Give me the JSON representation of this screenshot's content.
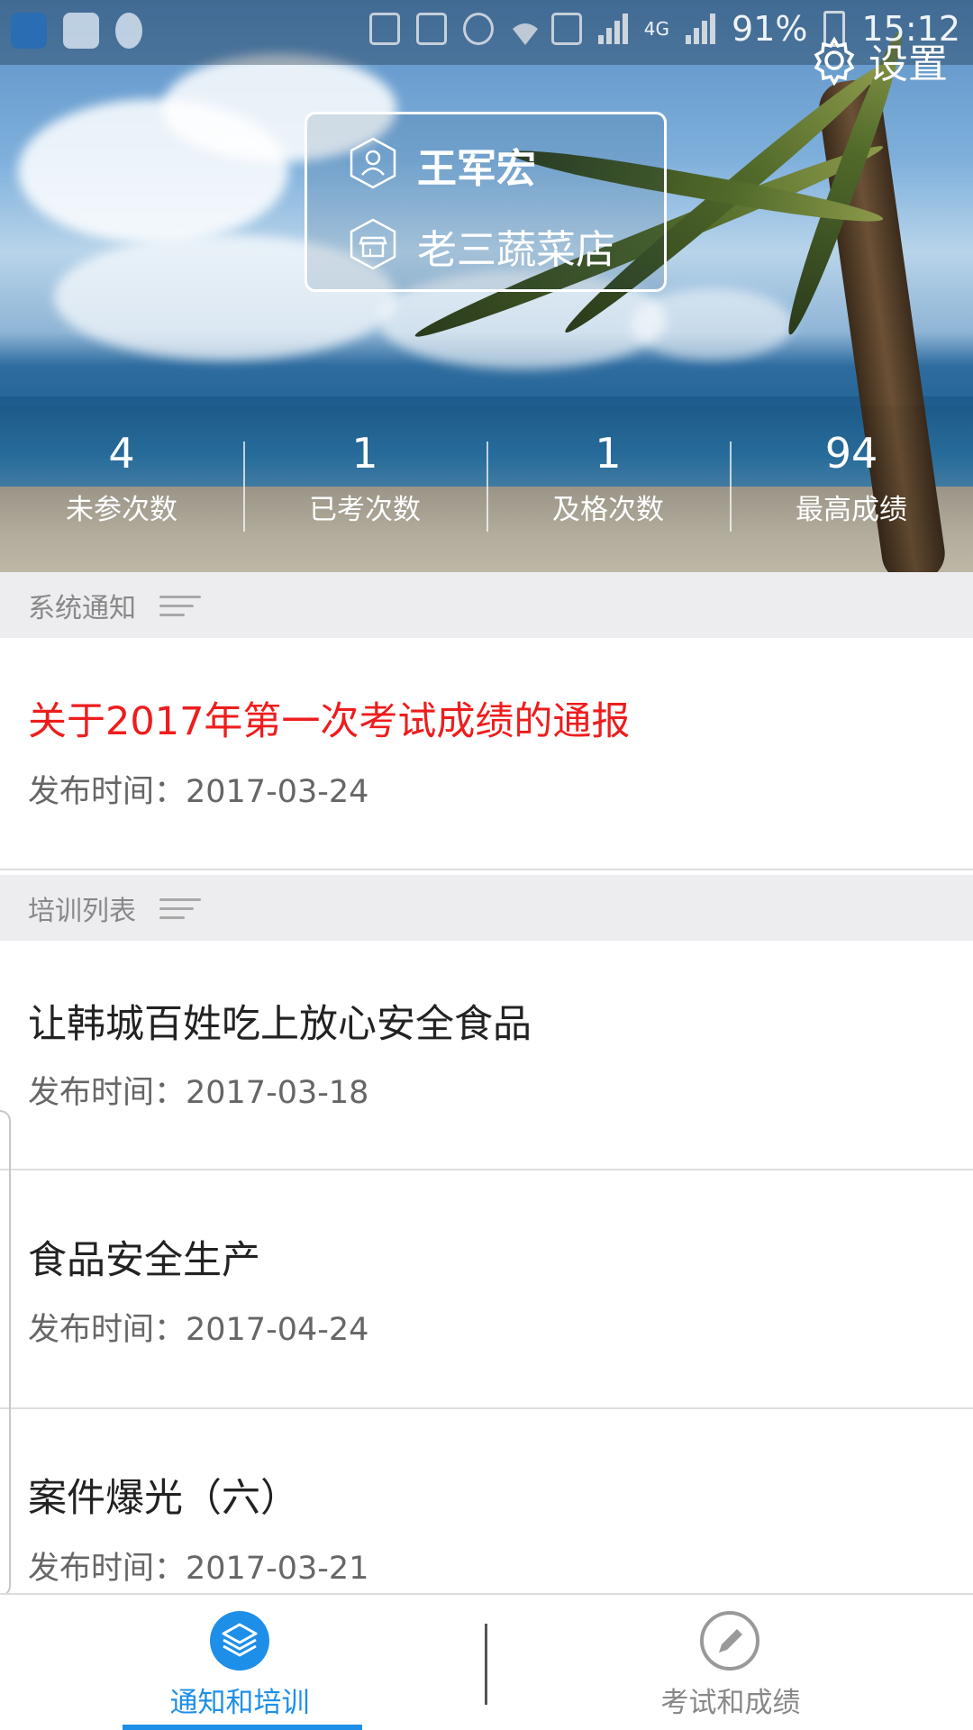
{
  "app": {
    "settings_label": "设置",
    "user_name": "王军宏",
    "shop_name": "老三蔬菜店"
  },
  "statusbar": {
    "battery": "91%",
    "time": "15:12",
    "network": "4G"
  },
  "stats": [
    {
      "value": "4",
      "label": "未参次数"
    },
    {
      "value": "1",
      "label": "已考次数"
    },
    {
      "value": "1",
      "label": "及格次数"
    },
    {
      "value": "94",
      "label": "最高成绩"
    }
  ],
  "notices": {
    "header": "系统通知",
    "items": [
      {
        "title": "关于2017年第一次考试成绩的通报",
        "date": "发布时间：2017-03-24"
      }
    ]
  },
  "trainings": {
    "header": "培训列表",
    "items": [
      {
        "title": "让韩城百姓吃上放心安全食品",
        "date": "发布时间：2017-03-18"
      },
      {
        "title": "食品安全生产",
        "date": "发布时间：2017-04-24"
      },
      {
        "title": "案件爆光（六）",
        "date": "发布时间：2017-03-21"
      }
    ]
  },
  "bottom_nav": {
    "tabs": [
      {
        "label": "通知和培训",
        "icon": "layers-icon",
        "active": true
      },
      {
        "label": "考试和成绩",
        "icon": "pencil-icon",
        "active": false
      }
    ]
  },
  "colors": {
    "accent": "#1d8fe8",
    "notice_title": "#ee1d1d",
    "section_bg": "#ededf0"
  }
}
